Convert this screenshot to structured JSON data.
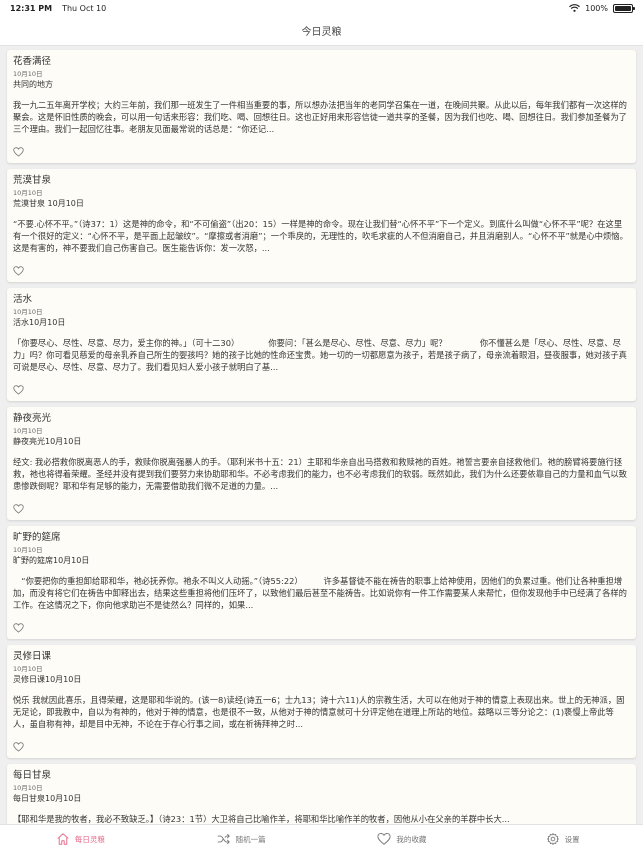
{
  "status": {
    "time": "12:31 PM",
    "date": "Thu Oct 10",
    "battery": "100%"
  },
  "nav": {
    "title": "今日灵粮"
  },
  "cards": [
    {
      "title": "花香满径",
      "date": "10月10日",
      "subtitle": "共同的地方",
      "body": "我一九二五年离开学校；大约三年前，我们那一班发生了一件相当重要的事，所以想办法把当年的老同学召集在一道，在晚间共聚。从此以后，每年我们都有一次这样的聚会。这是怀旧性质的晚会，可以用一句话来形容：我们吃、喝、回想往日。这也正好用来形容信徒一道共享的圣餐，因为我们也吃、喝、回想往日。我们参加圣餐为了三个理由。我们一起回忆往事。老朋友见面最常说的话总是：“你还记..."
    },
    {
      "title": "荒漠甘泉",
      "date": "10月10日",
      "subtitle": "荒漠甘泉 10月10日",
      "body": "“不要.心怀不平。”（诗37：1）这是神的命令，和“不可偷盗”（出20：15）一样是神的命令。现在让我们替“心怀不平”下一个定义。到底什么叫做“心怀不平”呢？在这里有一个很好的定义：“心怀不平，是平面上起皱纹”。“摩擦或者消磨”；一个乖戾的，无理性的，吹毛求疵的人不但消磨自己，并且消磨别人。“心怀不平”就是心中烦恼。这是有害的，神不要我们自己伤害自己。医生能告诉你：发一次怒，..."
    },
    {
      "title": "活水",
      "date": "10月10日",
      "subtitle": "活水10月10日",
      "body": "「你要尽心、尽性、尽意、尽力，爱主你的神。」（可十二30）　　　　你要问：「甚么是尽心、尽性、尽意、尽力」呢？　　　　你不懂甚么是「尽心、尽性、尽意、尽力」吗？你可看见慈爱的母亲乳养自己所生的婴孩吗？她的孩子比她的性命还宝贵。她一切的一切都愿意为孩子，若是孩子病了，母亲流着眼泪，昼夜服事，她对孩子真可说是尽心、尽性、尽意、尽力了。我们看见妇人爱小孩子就明白了基..."
    },
    {
      "title": "静夜亮光",
      "date": "10月10日",
      "subtitle": "静夜亮光10月10日",
      "body": "经文: 我必搭救你脱离恶人的手，救赎你脱离强暴人的手。（耶利米书十五：21）主耶和华亲自出马搭救和救赎祂的百姓。祂誓言要亲自拯救他们。祂的膀臂将要施行拯救，祂也将得着荣耀。圣经并没有提到我们要努力来协助耶和华。不必考虑我们的能力，也不必考虑我们的软弱。既然如此，我们为什么还要依靠自己的力量和血气以致患惨跌倒呢？耶和华有足够的能力，无需要借助我们微不足道的力量。..."
    },
    {
      "title": "旷野的筵席",
      "date": "10月10日",
      "subtitle": "旷野的筵席10月10日",
      "body": "　“你要把你的重担卸给耶和华，祂必抚养你。祂永不叫义人动摇。”（诗55:22）　　　许多基督徒不能在祷告的职事上给神使用，因他们的负累过重。他们让各种重担增加，而没有将它们在祷告中卸释出去，结果这些重担将他们压坏了，以致他们最后甚至不能祷告。比如说你有一件工作需要某人来帮忙，但你发现他手中已经满了各样的工作。在这情况之下，你向他求助岂不是徒然么？同样的，如果..."
    },
    {
      "title": "灵修日课",
      "date": "10月10日",
      "subtitle": "灵修日课10月10日",
      "body": "悦乐 我就因此喜乐，且得荣耀，这是耶和华说的。(该一8)读经(诗五一6；士九13；诗十六11)人的宗教生活，大可以在他对于神的情意上表现出来。世上的无神派，固无足论，即我教中，自以为有神的，他对于神的情意，也是很不一致，从他对于神的情意就可十分评定他在道理上所站的地位。兹略以三等分论之：(1)亵慢上帝此等人，虽自称有神，却是目中无神，不论在于存心行事之间，或在祈祷拜神之时..."
    },
    {
      "title": "每日甘泉",
      "date": "10月10日",
      "subtitle": "每日甘泉10月10日",
      "body": "【耶和华是我的牧者，我必不致缺乏。】（诗23：1节）大卫将自己比喻作羊，将耶和华比喻作羊的牧者，因他从小在父亲的羊群中长大..."
    }
  ],
  "tabs": [
    {
      "label": "每日灵粮",
      "icon": "home-icon",
      "active": true
    },
    {
      "label": "随机一篇",
      "icon": "shuffle-icon",
      "active": false
    },
    {
      "label": "我的收藏",
      "icon": "heart-icon",
      "active": false
    },
    {
      "label": "设置",
      "icon": "gear-icon",
      "active": false
    }
  ],
  "colors": {
    "accent": "#e46a8a",
    "card_bg": "#fdfcf7",
    "page_bg": "#efefef"
  }
}
